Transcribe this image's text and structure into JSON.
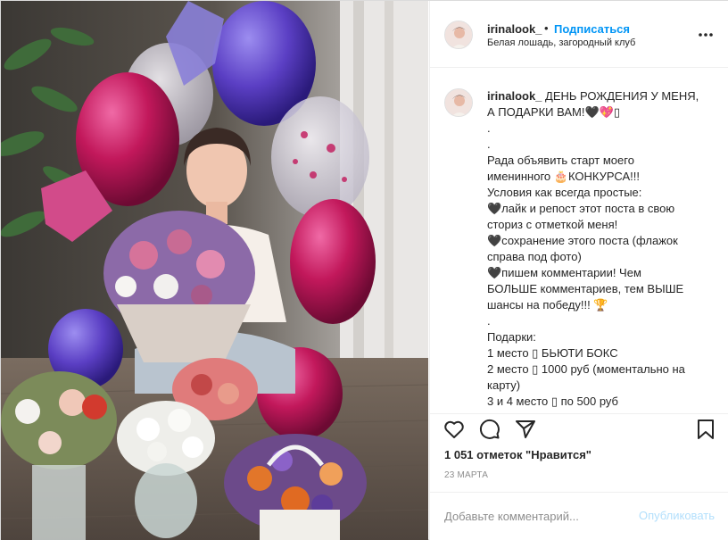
{
  "post": {
    "username": "irinalook_",
    "separator": "•",
    "follow_label": "Подписаться",
    "location": "Белая лошадь, загородный клуб",
    "more_icon": "more-horizontal-icon"
  },
  "caption": {
    "username": "irinalook_",
    "text": " ДЕНЬ РОЖДЕНИЯ У МЕНЯ,\nА ПОДАРКИ ВАМ!🖤💖▯\n.\n.\nРада объявить старт моего\nименинного 🎂КОНКУРСА!!!\nУсловия как всегда простые:\n🖤лайк и репост этот поста в свою\nсториз с отметкой меня!\n🖤сохранение этого поста (флажок\nсправа под фото)\n🖤пишем комментарии! Чем\nБОЛЬШЕ комментариев, тем ВЫШЕ\nшансы на победу!!! 🏆\n.\nПодарки:\n1 место ▯ БЬЮТИ БОКС\n2 место ▯ 1000 руб (моментально на\nкарту)\n3 и 4 место ▯ по 500 руб"
  },
  "actions": {
    "like_icon": "heart-icon",
    "comment_icon": "comment-icon",
    "share_icon": "share-icon",
    "save_icon": "bookmark-icon",
    "likes_text": "1 051 отметок \"Нравится\"",
    "date": "23 МАРТА"
  },
  "add_comment": {
    "placeholder": "Добавьте комментарий...",
    "publish_label": "Опубликовать"
  },
  "colors": {
    "link_blue": "#0095f6",
    "publish_disabled": "#b2dffc",
    "muted": "#8e8e8e",
    "text": "#262626"
  }
}
